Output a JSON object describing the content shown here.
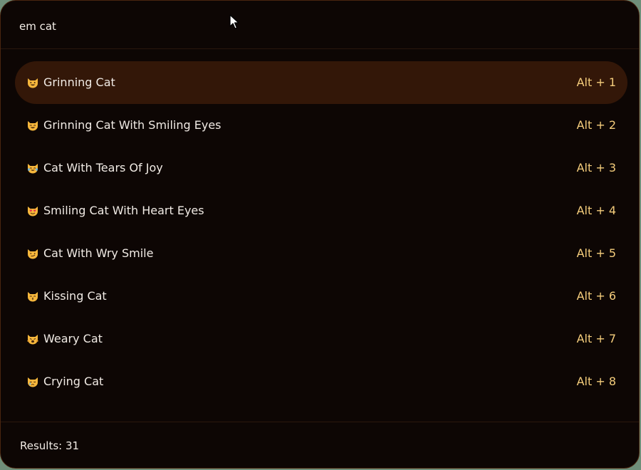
{
  "search": {
    "value": "em cat",
    "placeholder": ""
  },
  "results": [
    {
      "emoji_icon": "grinning-cat-icon",
      "label": "Grinning Cat",
      "shortcut": "Alt + 1",
      "selected": true
    },
    {
      "emoji_icon": "grinning-cat-smiling-eyes-icon",
      "label": "Grinning Cat With Smiling Eyes",
      "shortcut": "Alt + 2",
      "selected": false
    },
    {
      "emoji_icon": "cat-tears-of-joy-icon",
      "label": "Cat With Tears Of Joy",
      "shortcut": "Alt + 3",
      "selected": false
    },
    {
      "emoji_icon": "smiling-cat-heart-eyes-icon",
      "label": "Smiling Cat With Heart Eyes",
      "shortcut": "Alt + 4",
      "selected": false
    },
    {
      "emoji_icon": "cat-wry-smile-icon",
      "label": "Cat With Wry Smile",
      "shortcut": "Alt + 5",
      "selected": false
    },
    {
      "emoji_icon": "kissing-cat-icon",
      "label": "Kissing Cat",
      "shortcut": "Alt + 6",
      "selected": false
    },
    {
      "emoji_icon": "weary-cat-icon",
      "label": "Weary Cat",
      "shortcut": "Alt + 7",
      "selected": false
    },
    {
      "emoji_icon": "crying-cat-icon",
      "label": "Crying Cat",
      "shortcut": "Alt + 8",
      "selected": false
    }
  ],
  "footer": {
    "results_label": "Results: 31"
  },
  "colors": {
    "background": "#0d0604",
    "selected_row": "#331708",
    "text": "#f1ebe5",
    "shortcut": "#f5cd7c",
    "cat_face": "#f6b73c"
  }
}
